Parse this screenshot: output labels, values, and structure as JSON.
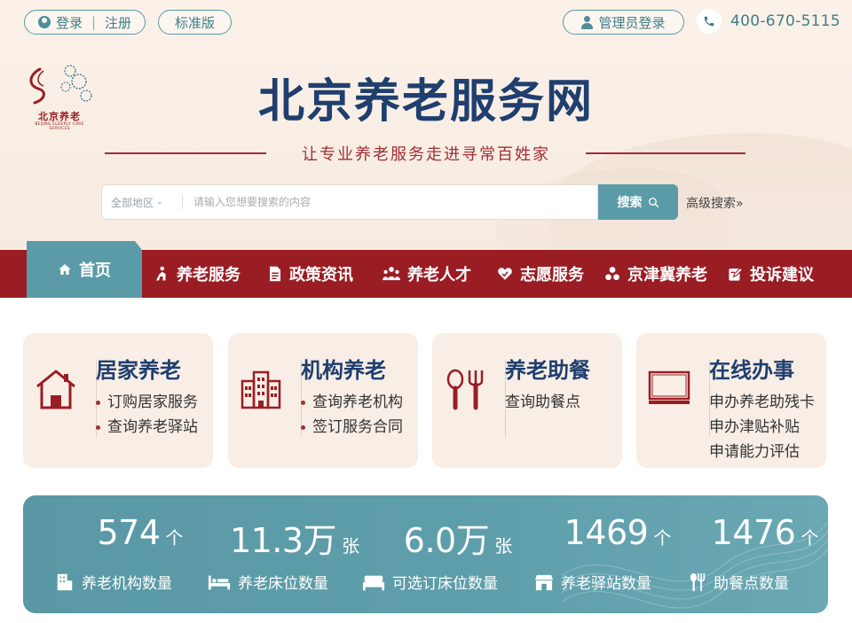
{
  "topbar": {
    "login_label": "登录",
    "register_label": "注册",
    "login_sep": "|",
    "standard_label": "标准版",
    "admin_login_label": "管理员登录",
    "hotline": "400-670-5115"
  },
  "logo": {
    "text": "北京养老",
    "subtext": "BEIJING ELDERLY CARE SERVICES"
  },
  "site": {
    "title": "北京养老服务网",
    "slogan": "让专业养老服务走进寻常百姓家"
  },
  "search": {
    "region_label": "全部地区",
    "placeholder": "请输入您想要搜索的内容",
    "button_label": "搜索",
    "advanced_label": "高级搜索»"
  },
  "nav": {
    "items": [
      {
        "label": "首页",
        "icon": "home-icon",
        "active": true
      },
      {
        "label": "养老服务",
        "icon": "elder-service-icon"
      },
      {
        "label": "政策资讯",
        "icon": "document-icon"
      },
      {
        "label": "养老人才",
        "icon": "people-icon"
      },
      {
        "label": "志愿服务",
        "icon": "heart-hand-icon"
      },
      {
        "label": "京津冀养老",
        "icon": "region-icon"
      },
      {
        "label": "投诉建议",
        "icon": "edit-icon"
      }
    ]
  },
  "cards": [
    {
      "title": "居家养老",
      "icon": "house-icon",
      "links": [
        "订购居家服务",
        "查询养老驿站"
      ],
      "bullets": true
    },
    {
      "title": "机构养老",
      "icon": "building-icon",
      "links": [
        "查询养老机构",
        "签订服务合同"
      ],
      "bullets": true
    },
    {
      "title": "养老助餐",
      "icon": "meal-icon",
      "links": [
        "查询助餐点"
      ],
      "bullets": false
    },
    {
      "title": "在线办事",
      "icon": "monitor-icon",
      "links": [
        "申办养老助残卡",
        "申办津贴补贴",
        "申请能力评估"
      ],
      "bullets": false
    }
  ],
  "stats": [
    {
      "value": "574",
      "unit": "个",
      "label": "养老机构数量",
      "icon": "institution-icon"
    },
    {
      "value": "11.3万",
      "unit": "张",
      "label": "养老床位数量",
      "icon": "bed-icon"
    },
    {
      "value": "6.0万",
      "unit": "张",
      "label": "可选订床位数量",
      "icon": "bed-select-icon"
    },
    {
      "value": "1469",
      "unit": "个",
      "label": "养老驿站数量",
      "icon": "station-icon"
    },
    {
      "value": "1476",
      "unit": "个",
      "label": "助餐点数量",
      "icon": "dining-icon"
    }
  ],
  "colors": {
    "navy": "#1f3f6e",
    "crimson": "#9a1d24",
    "teal": "#5a9ba7",
    "cream": "#f8eee6"
  }
}
